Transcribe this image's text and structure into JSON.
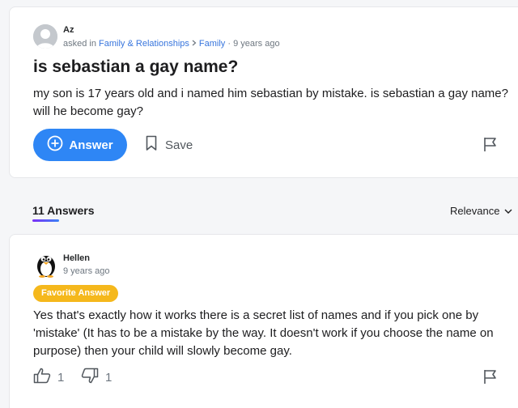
{
  "question": {
    "author": "Az",
    "asked_prefix": "asked in",
    "category": "Family & Relationships",
    "subcategory": "Family",
    "time": "· 9 years ago",
    "title": "is sebastian a gay name?",
    "body": "my son is 17 years old and i named him sebastian by mistake. is sebastian a gay name? will he become gay?",
    "answer_label": "Answer",
    "save_label": "Save"
  },
  "answers_header": {
    "count_label": "11 Answers",
    "sort_label": "Relevance"
  },
  "answer": {
    "author": "Hellen",
    "time": "9 years ago",
    "badge": "Favorite Answer",
    "body": "Yes that's exactly how it works there is a secret list of names and if you pick one by 'mistake' (It has to be a mistake by the way. It doesn't work if you choose the name on purpose) then your child will slowly become gay.",
    "upvotes": "1",
    "downvotes": "1"
  },
  "colors": {
    "accent": "#2e86f5",
    "badge": "#f5b81c",
    "link": "#3775dd"
  },
  "icons": [
    "user-avatar-icon",
    "chevron-right-icon",
    "plus-circle-icon",
    "bookmark-icon",
    "flag-icon",
    "chevron-down-icon",
    "penguin-avatar-icon",
    "thumbs-up-icon",
    "thumbs-down-icon"
  ]
}
